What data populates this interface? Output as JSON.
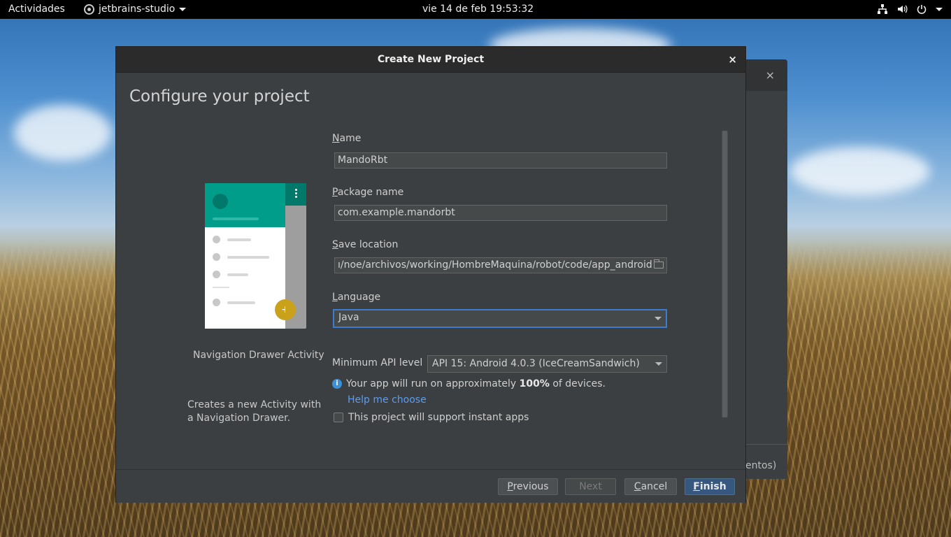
{
  "topbar": {
    "activities": "Actividades",
    "app_name": "jetbrains-studio",
    "clock": "vie 14 de feb  19:53:32"
  },
  "background_window": {
    "close_glyph": "×",
    "partial_text": "entos)"
  },
  "dialog": {
    "title": "Create New Project",
    "close_glyph": "×",
    "heading": "Configure your project",
    "activity": {
      "name": "Navigation Drawer Activity",
      "description": "Creates a new Activity with a Navigation Drawer."
    },
    "form": {
      "name_label_first": "N",
      "name_label_rest": "ame",
      "name_value": "MandoRbt",
      "package_label_first": "P",
      "package_label_rest": "ackage name",
      "package_value": "com.example.mandorbt",
      "location_label_first": "S",
      "location_label_rest": "ave location",
      "location_value": "ı/noe/archivos/working/HombreMaquina/robot/code/app_android",
      "language_label_first": "L",
      "language_label_rest": "anguage",
      "language_value": "Java",
      "min_api_label": "Minimum API level",
      "min_api_value": "API 15: Android 4.0.3 (IceCreamSandwich)",
      "info_prefix": "Your app will run on approximately",
      "info_percent": "100%",
      "info_suffix": "of devices.",
      "help_link": "Help me choose",
      "instant_apps_label": "This project will support instant apps",
      "instant_apps_checked": false
    },
    "buttons": {
      "previous_first": "P",
      "previous_rest": "revious",
      "next": "Next",
      "cancel_first": "C",
      "cancel_rest": "ancel",
      "finish_first": "F",
      "finish_rest": "inish"
    }
  },
  "colors": {
    "accent": "#3d7bcd",
    "link": "#589df6",
    "teal": "#009e8a",
    "fab": "#c9a11a"
  }
}
